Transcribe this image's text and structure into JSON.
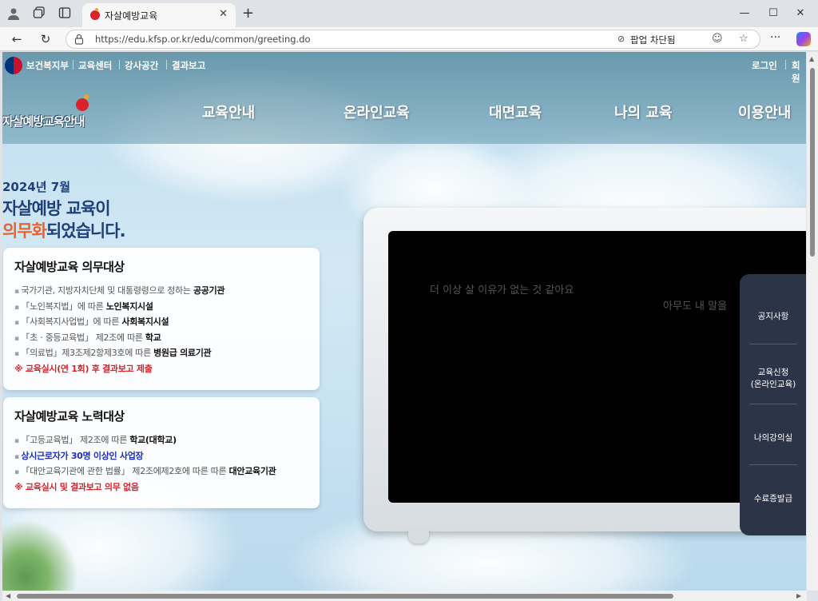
{
  "browser": {
    "tab_title": "자살예방교육",
    "url": "https://edu.kfsp.or.kr/edu/common/greeting.do",
    "popup_blocked_label": "팝업 차단됨"
  },
  "header": {
    "ministry": "보건복지부",
    "util_links": [
      "교육센터",
      "강사공간",
      "결과보고"
    ],
    "login": "로그인",
    "signup": "회원",
    "site_name": "자살예방교육안내",
    "gnb": [
      "교육안내",
      "온라인교육",
      "대면교육",
      "나의 교육",
      "이용안내"
    ]
  },
  "headline": {
    "date": "2024년 7월",
    "line1": "자살예방 교육이",
    "line2_accent": "의무화",
    "line2_rest": "되었습니다."
  },
  "mandatory": {
    "title": "자살예방교육 의무대상",
    "items": [
      {
        "text": "국가기관, 지방자치단체 및 대통령령으로 정하는 ",
        "bold": "공공기관"
      },
      {
        "text": "「노인복지법」에 따른 ",
        "bold": "노인복지시설"
      },
      {
        "text": "「사회복지사업법」에 따른 ",
        "bold": "사회복지시설"
      },
      {
        "text": "「초ㆍ중등교육법」 제2조에 따른 ",
        "bold": "학교"
      },
      {
        "text": "「의료법」제3조제2항제3호에 따른 ",
        "bold": "병원급 의료기관"
      }
    ],
    "note": "※ 교육실시(연 1회) 후 결과보고 제출"
  },
  "effort": {
    "title": "자살예방교육 노력대상",
    "items": [
      {
        "text": "「고등교육법」 제2조에 따른 ",
        "bold": "학교(대학교)"
      },
      {
        "text": "상시근로자가 30명 이상인 사업장",
        "bold": ""
      },
      {
        "text": "「대안교육기관에 관한 법률」 제2조에제2호에 따른 따른 ",
        "bold": "대안교육기관"
      }
    ],
    "note": "※ 교육실시 및 결과보고 의무 없음"
  },
  "video": {
    "caption1": "더 이상 살 이유가 없는 것 같아요",
    "caption2": "아무도 내 말을"
  },
  "quick_menu": [
    "공지사항",
    "교육신청\n(온라인교육)",
    "나의강의실",
    "수료증발급"
  ]
}
